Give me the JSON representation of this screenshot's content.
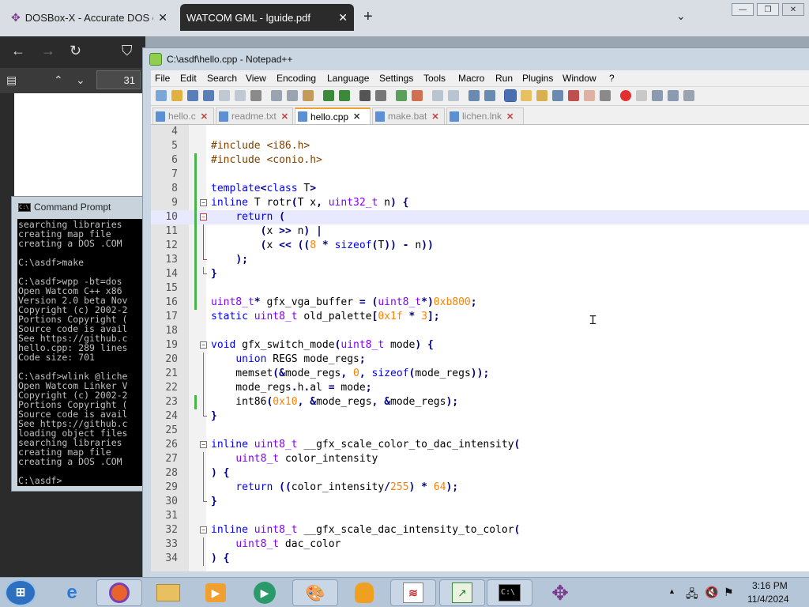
{
  "browser": {
    "tabs": [
      {
        "title": "DOSBox-X - Accurate DOS emu",
        "close": "✕"
      },
      {
        "title": "WATCOM GML - lguide.pdf",
        "close": "✕"
      }
    ],
    "new_tab": "+",
    "list_all_tabs": "⌄",
    "window_controls": [
      "—",
      "❐",
      "✕"
    ],
    "pdf_page_number": "31"
  },
  "cmd": {
    "title": "Command Prompt",
    "lines": [
      "searching libraries",
      "creating map file",
      "creating a DOS .COM",
      "",
      "C:\\asdf>make",
      "",
      "C:\\asdf>wpp -bt=dos",
      "Open Watcom C++ x86",
      "Version 2.0 beta Nov",
      "Copyright (c) 2002-2",
      "Portions Copyright (",
      "Source code is avail",
      "See https://github.c",
      "hello.cpp: 289 lines",
      "Code size: 701",
      "",
      "C:\\asdf>wlink @liche",
      "Open Watcom Linker V",
      "Copyright (c) 2002-2",
      "Portions Copyright (",
      "Source code is avail",
      "See https://github.c",
      "loading object files",
      "searching libraries",
      "creating map file",
      "creating a DOS .COM",
      "",
      "C:\\asdf>"
    ]
  },
  "npp": {
    "title": "C:\\asdf\\hello.cpp - Notepad++",
    "menu": [
      "File",
      "Edit",
      "Search",
      "View",
      "Encoding",
      "Language",
      "Settings",
      "Tools",
      "Macro",
      "Run",
      "Plugins",
      "Window",
      "?"
    ],
    "tabs": [
      {
        "label": "hello.c",
        "active": false
      },
      {
        "label": "readme.txt",
        "active": false
      },
      {
        "label": "hello.cpp",
        "active": true
      },
      {
        "label": "make.bat",
        "active": false
      },
      {
        "label": "lichen.lnk",
        "active": false
      }
    ],
    "tab_close": "✕",
    "code": [
      {
        "n": "4",
        "text": ""
      },
      {
        "n": "5",
        "text": "#include <i86.h>"
      },
      {
        "n": "6",
        "text": "#include <conio.h>"
      },
      {
        "n": "7",
        "text": ""
      },
      {
        "n": "8",
        "text": "template<class T>"
      },
      {
        "n": "9",
        "text": "inline T rotr(T x, uint32_t n) {"
      },
      {
        "n": "10",
        "text": "    return ("
      },
      {
        "n": "11",
        "text": "        (x >> n) |"
      },
      {
        "n": "12",
        "text": "        (x << ((8 * sizeof(T)) - n))"
      },
      {
        "n": "13",
        "text": "    );"
      },
      {
        "n": "14",
        "text": "}"
      },
      {
        "n": "15",
        "text": ""
      },
      {
        "n": "16",
        "text": "uint8_t* gfx_vga_buffer = (uint8_t*)0xb800;"
      },
      {
        "n": "17",
        "text": "static uint8_t old_palette[0x1f * 3];"
      },
      {
        "n": "18",
        "text": ""
      },
      {
        "n": "19",
        "text": "void gfx_switch_mode(uint8_t mode) {"
      },
      {
        "n": "20",
        "text": "    union REGS mode_regs;"
      },
      {
        "n": "21",
        "text": "    memset(&mode_regs, 0, sizeof(mode_regs));"
      },
      {
        "n": "22",
        "text": "    mode_regs.h.al = mode;"
      },
      {
        "n": "23",
        "text": "    int86(0x10, &mode_regs, &mode_regs);"
      },
      {
        "n": "24",
        "text": "}"
      },
      {
        "n": "25",
        "text": ""
      },
      {
        "n": "26",
        "text": "inline uint8_t __gfx_scale_color_to_dac_intensity("
      },
      {
        "n": "27",
        "text": "    uint8_t color_intensity"
      },
      {
        "n": "28",
        "text": ") {"
      },
      {
        "n": "29",
        "text": "    return ((color_intensity/255) * 64);"
      },
      {
        "n": "30",
        "text": "}"
      },
      {
        "n": "31",
        "text": ""
      },
      {
        "n": "32",
        "text": "inline uint8_t __gfx_scale_dac_intensity_to_color("
      },
      {
        "n": "33",
        "text": "    uint8_t dac_color"
      },
      {
        "n": "34",
        "text": ") {"
      }
    ]
  },
  "taskbar": {
    "start_label": "⊞",
    "time": "3:16 PM",
    "date": "11/4/2024",
    "show_hidden_icons": "▲"
  }
}
